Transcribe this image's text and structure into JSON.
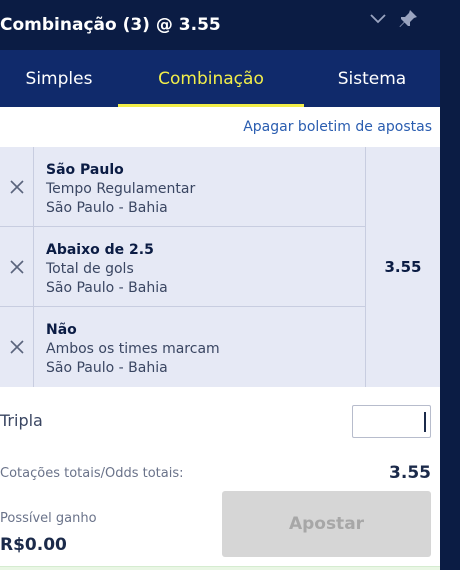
{
  "header": {
    "title": "Combinação (3)",
    "odds_text": "@ 3.55",
    "icons": [
      "chevron-down-icon",
      "pin-icon"
    ]
  },
  "tabs": [
    {
      "label": "Simples",
      "active": false
    },
    {
      "label": "Combinação",
      "active": true
    },
    {
      "label": "Sistema",
      "active": false
    }
  ],
  "clear_link": "Apagar boletim de apostas",
  "bets": [
    {
      "selection": "São Paulo",
      "market": "Tempo Regulamentar",
      "event": "São Paulo - Bahia"
    },
    {
      "selection": "Abaixo de 2.5",
      "market": "Total de gols",
      "event": "São Paulo - Bahia"
    },
    {
      "selection": "Não",
      "market": "Ambos os times marcam",
      "event": "São Paulo - Bahia"
    }
  ],
  "combined_odds": "3.55",
  "stake": {
    "label": "Tripla",
    "value": ""
  },
  "totals": {
    "label": "Cotações totais/Odds totais:",
    "value": "3.55"
  },
  "possible_win": {
    "label": "Possível ganho",
    "value": "R$0.00"
  },
  "bet_button": "Apostar",
  "colors": {
    "header_bg": "#0b1c44",
    "tabs_bg": "#102a6b",
    "active_tab": "#f2ee4a",
    "link": "#2a5db0",
    "selections_bg": "#e6e9f5",
    "disabled_button": "#d6d6d6"
  }
}
